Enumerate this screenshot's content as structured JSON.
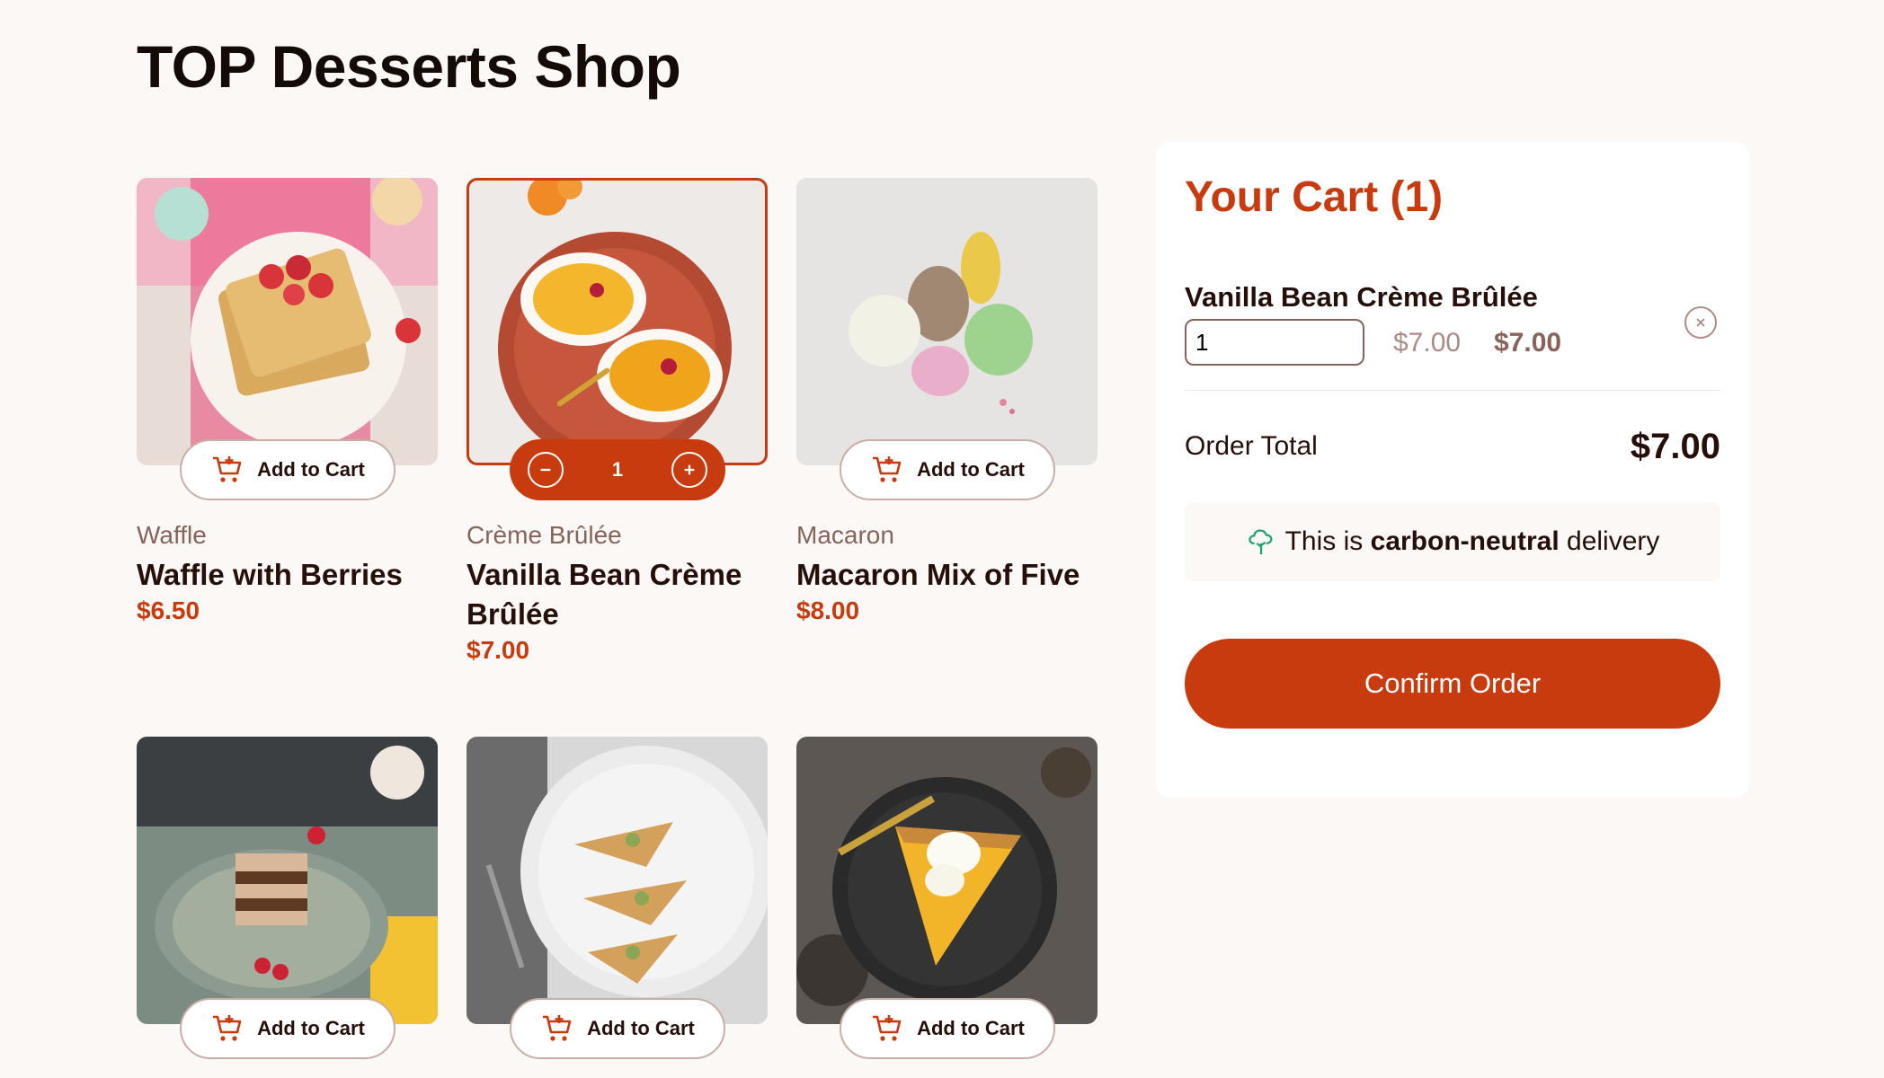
{
  "page": {
    "title": "TOP Desserts Shop"
  },
  "products": [
    {
      "category": "Waffle",
      "name": "Waffle with Berries",
      "price": "$6.50",
      "button_label": "Add to Cart"
    },
    {
      "category": "Crème Brûlée",
      "name": "Vanilla Bean Crème Brûlée",
      "price": "$7.00",
      "quantity": "1"
    },
    {
      "category": "Macaron",
      "name": "Macaron Mix of Five",
      "price": "$8.00",
      "button_label": "Add to Cart"
    },
    {
      "button_label": "Add to Cart"
    },
    {
      "button_label": "Add to Cart"
    },
    {
      "button_label": "Add to Cart"
    }
  ],
  "cart": {
    "title": "Your Cart (1)",
    "items": [
      {
        "name": "Vanilla Bean Crème Brûlée",
        "quantity": "1",
        "unit_price": "$7.00",
        "line_total": "$7.00"
      }
    ],
    "order_total_label": "Order Total",
    "order_total_value": "$7.00",
    "carbon_prefix": "This is",
    "carbon_bold": "carbon-neutral",
    "carbon_suffix": "delivery",
    "confirm_label": "Confirm Order"
  },
  "colors": {
    "accent": "#c73b0f",
    "text": "#260f08",
    "muted": "#87635a",
    "background": "#fcf8f6",
    "green": "#1ea575"
  },
  "icons": [
    "cart-plus-icon",
    "minus-icon",
    "plus-icon",
    "remove-icon",
    "carbon-neutral-tree-icon"
  ]
}
